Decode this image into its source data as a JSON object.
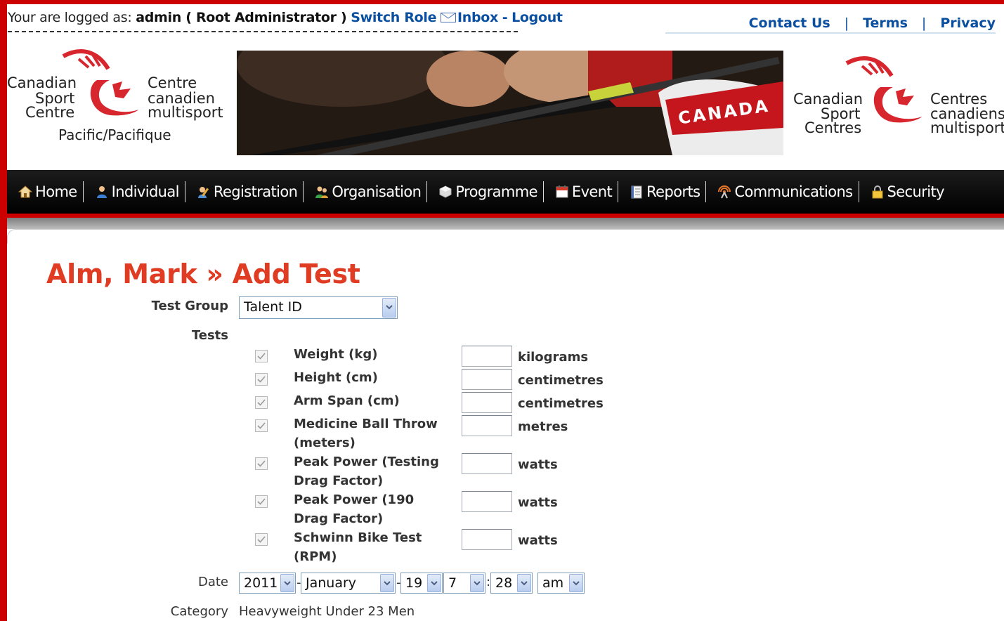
{
  "login": {
    "prefix": "Your are logged as:",
    "user": "admin ( Root Administrator )",
    "switch_role": "Switch Role",
    "inbox": "Inbox",
    "dash": "-",
    "logout": "Logout"
  },
  "toplinks": {
    "contact": "Contact Us",
    "terms": "Terms",
    "privacy": "Privacy",
    "sep": "|"
  },
  "logo_left": {
    "line1": "Canadian",
    "line2": "Sport",
    "line3": "Centre",
    "line4": "Centre",
    "line5": "canadien",
    "line6": "multisport",
    "region": "Pacific/Pacifique"
  },
  "logo_right": {
    "line1": "Canadian",
    "line2": "Sport",
    "line3": "Centres",
    "line4": "Centres",
    "line5": "canadiens",
    "line6": "multisport"
  },
  "banner_text": "CANADA",
  "nav": [
    {
      "label": "Home",
      "icon": "home-icon"
    },
    {
      "label": "Individual",
      "icon": "person-icon"
    },
    {
      "label": "Registration",
      "icon": "registration-icon"
    },
    {
      "label": "Organisation",
      "icon": "organisation-icon"
    },
    {
      "label": "Programme",
      "icon": "programme-icon"
    },
    {
      "label": "Event",
      "icon": "calendar-icon"
    },
    {
      "label": "Reports",
      "icon": "reports-icon"
    },
    {
      "label": "Communications",
      "icon": "communications-icon"
    },
    {
      "label": "Security",
      "icon": "lock-icon"
    }
  ],
  "page": {
    "title": "Alm, Mark » Add Test",
    "test_group_label": "Test Group",
    "test_group_value": "Talent ID",
    "tests_label": "Tests",
    "tests": [
      {
        "name": "Weight (kg)",
        "unit": "kilograms",
        "checked": true,
        "value": ""
      },
      {
        "name": "Height (cm)",
        "unit": "centimetres",
        "checked": true,
        "value": ""
      },
      {
        "name": "Arm Span (cm)",
        "unit": "centimetres",
        "checked": true,
        "value": ""
      },
      {
        "name": "Medicine Ball Throw (meters)",
        "unit": "metres",
        "checked": true,
        "value": ""
      },
      {
        "name": "Peak Power (Testing Drag Factor)",
        "unit": "watts",
        "checked": true,
        "value": ""
      },
      {
        "name": "Peak Power (190 Drag Factor)",
        "unit": "watts",
        "checked": true,
        "value": ""
      },
      {
        "name": "Schwinn Bike Test (RPM)",
        "unit": "watts",
        "checked": true,
        "value": ""
      }
    ],
    "date_label": "Date",
    "date": {
      "year": "2011",
      "month": "January",
      "day": "19",
      "hour": "7",
      "minute": "28",
      "ampm": "am",
      "dash": "-",
      "colon": ":"
    },
    "category_label": "Category",
    "category_value": "Heavyweight Under 23 Men"
  },
  "colors": {
    "frame": "#cc0000",
    "title": "#e03b23",
    "link": "#0b4fa0"
  }
}
